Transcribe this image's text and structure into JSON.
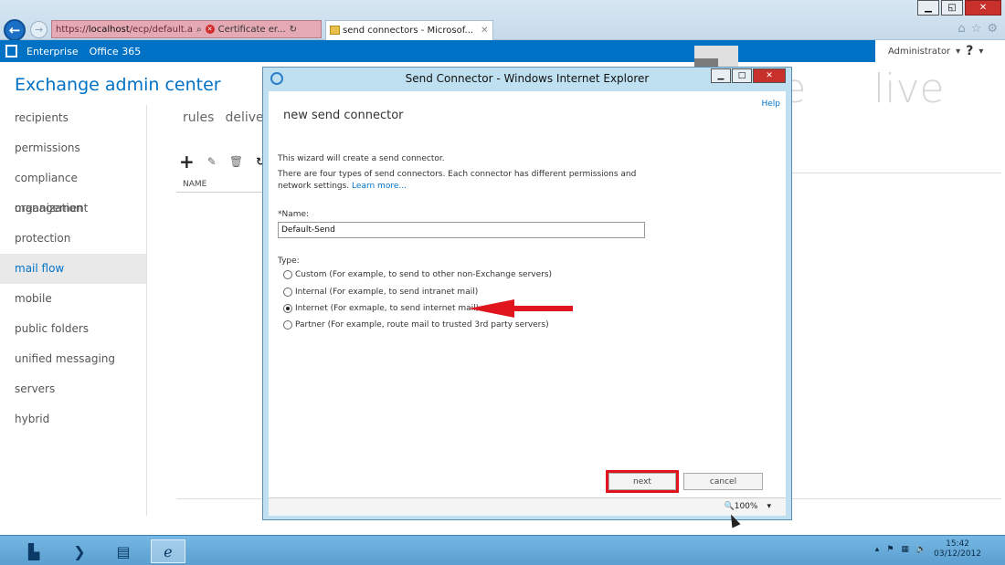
{
  "browser": {
    "address_url_prefix": "https://",
    "address_url_host": "localhost",
    "address_url_path": "/ecp/default.aspx",
    "cert_error_label": "Certificate er...",
    "tab_title": "send connectors - Microsof..."
  },
  "office_bar": {
    "enterprise": "Enterprise",
    "office365": "Office 365",
    "admin_user": "Administrator",
    "help": "?"
  },
  "eac": {
    "title": "Exchange admin center",
    "nav": [
      "recipients",
      "permissions",
      "compliance management",
      "organization",
      "protection",
      "mail flow",
      "mobile",
      "public folders",
      "unified messaging",
      "servers",
      "hybrid"
    ],
    "active_nav": "mail flow",
    "subtabs": [
      "rules",
      "delivery"
    ],
    "column_name": "NAME"
  },
  "watermark": {
    "word1": "pete",
    "word2": "live"
  },
  "dialog": {
    "window_title": "Send Connector - Windows Internet Explorer",
    "heading": "new send connector",
    "help_link": "Help",
    "intro": "This wizard will create a send connector.",
    "types_desc": "There are four types of send connectors. Each connector has different permissions and",
    "types_desc2": "network settings.",
    "learn_more": "Learn more...",
    "name_label": "*Name:",
    "name_value": "Default-Send",
    "type_label": "Type:",
    "options": [
      "Custom (For example, to send to other non-Exchange servers)",
      "Internal (For example, to send intranet mail)",
      "Internet (For exmaple, to send internet mail)",
      "Partner (For example, route mail to trusted 3rd party servers)"
    ],
    "selected_option": 2,
    "next": "next",
    "cancel": "cancel",
    "zoom": "100%"
  },
  "taskbar": {
    "time": "15:42",
    "date": "03/12/2012"
  },
  "colors": {
    "accent": "#0072c6",
    "highlight_red": "#e0141c"
  }
}
